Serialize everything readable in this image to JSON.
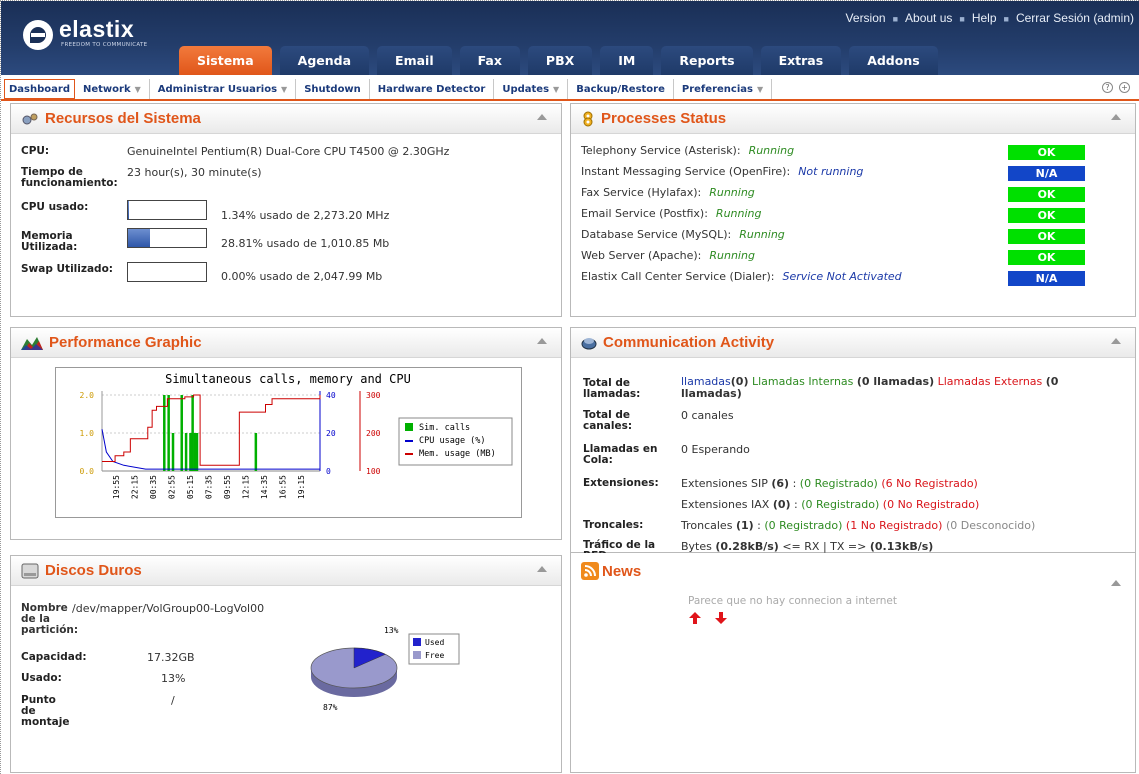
{
  "header": {
    "brand": "elastix",
    "tagline": "FREEDOM TO COMMUNICATE",
    "links": [
      "Version",
      "About us",
      "Help",
      "Cerrar Sesión (admin)"
    ],
    "tabs": [
      "Sistema",
      "Agenda",
      "Email",
      "Fax",
      "PBX",
      "IM",
      "Reports",
      "Extras",
      "Addons"
    ],
    "active_tab": "Sistema"
  },
  "submenu": {
    "items": [
      "Dashboard",
      "Network",
      "Administrar Usuarios",
      "Shutdown",
      "Hardware Detector",
      "Updates",
      "Backup/Restore",
      "Preferencias"
    ],
    "dropdown_marker": "▼",
    "help_icon": "?",
    "add_icon": "+"
  },
  "resources": {
    "title": "Recursos del Sistema",
    "cpu_label": "CPU:",
    "cpu_value": "GenuineIntel Pentium(R) Dual-Core CPU T4500 @ 2.30GHz",
    "uptime_label": "Tiempo de funcionamiento:",
    "uptime_value": "23 hour(s), 30 minute(s)",
    "cpu_used_label": "CPU usado:",
    "cpu_used_text": "1.34% usado de 2,273.20 MHz",
    "cpu_used_pct": 1.34,
    "mem_label": "Memoria Utilizada:",
    "mem_text": "28.81% usado de 1,010.85 Mb",
    "mem_pct": 28.81,
    "swap_label": "Swap Utilizado:",
    "swap_text": "0.00% usado de 2,047.99 Mb",
    "swap_pct": 0.0
  },
  "processes": {
    "title": "Processes Status",
    "items": [
      {
        "name": "Telephony Service (Asterisk):",
        "status": "Running",
        "badge": "OK",
        "state": "ok"
      },
      {
        "name": "Instant Messaging Service (OpenFire):",
        "status": "Not running",
        "badge": "N/A",
        "state": "na"
      },
      {
        "name": "Fax Service (Hylafax):",
        "status": "Running",
        "badge": "OK",
        "state": "ok"
      },
      {
        "name": "Email Service (Postfix):",
        "status": "Running",
        "badge": "OK",
        "state": "ok"
      },
      {
        "name": "Database Service (MySQL):",
        "status": "Running",
        "badge": "OK",
        "state": "ok"
      },
      {
        "name": "Web Server (Apache):",
        "status": "Running",
        "badge": "OK",
        "state": "ok"
      },
      {
        "name": "Elastix Call Center Service (Dialer):",
        "status": "Service Not Activated",
        "badge": "N/A",
        "state": "na"
      }
    ],
    "colors": {
      "ok": "#00e000",
      "na": "#1246c8",
      "running": "#2e8b22",
      "not_running": "#1c3aa8"
    }
  },
  "performance": {
    "title": "Performance Graphic",
    "chart_title": "Simultaneous calls, memory and CPU",
    "left_ticks": [
      "0.0",
      "1.0",
      "2.0"
    ],
    "mid_ticks": [
      "0",
      "20",
      "40"
    ],
    "right_ticks": [
      "100",
      "200",
      "300"
    ],
    "x_ticks": [
      "19:55",
      "22:15",
      "00:35",
      "02:55",
      "05:15",
      "07:35",
      "09:55",
      "12:15",
      "14:35",
      "16:55",
      "19:15"
    ],
    "legend": [
      "Sim. calls",
      "CPU usage (%)",
      "Mem. usage (MB)"
    ],
    "colors": {
      "calls": "#00b000",
      "cpu": "#0000cc",
      "mem": "#cc0000"
    }
  },
  "chart_data": {
    "type": "line",
    "title": "Simultaneous calls, memory and CPU",
    "x_categories": [
      "19:55",
      "22:15",
      "00:35",
      "02:55",
      "05:15",
      "07:35",
      "09:55",
      "12:15",
      "14:35",
      "16:55",
      "19:15"
    ],
    "series": [
      {
        "name": "Sim. calls",
        "axis": "left",
        "ylim": [
          0,
          2
        ],
        "kind": "bar",
        "points": [
          [
            0.28,
            2
          ],
          [
            0.3,
            2
          ],
          [
            0.32,
            1
          ],
          [
            0.36,
            2
          ],
          [
            0.38,
            1
          ],
          [
            0.4,
            1
          ],
          [
            0.41,
            2
          ],
          [
            0.42,
            1
          ],
          [
            0.43,
            1
          ],
          [
            0.7,
            1
          ]
        ]
      },
      {
        "name": "CPU usage (%)",
        "axis": "mid",
        "ylim": [
          0,
          40
        ],
        "points": [
          [
            0.0,
            22
          ],
          [
            0.02,
            10
          ],
          [
            0.05,
            5
          ],
          [
            0.1,
            3
          ],
          [
            0.2,
            1
          ],
          [
            1.0,
            1
          ]
        ]
      },
      {
        "name": "Mem. usage (MB)",
        "axis": "right",
        "ylim": [
          100,
          300
        ],
        "points": [
          [
            0.0,
            125
          ],
          [
            0.05,
            125
          ],
          [
            0.06,
            140
          ],
          [
            0.1,
            150
          ],
          [
            0.13,
            185
          ],
          [
            0.2,
            185
          ],
          [
            0.21,
            215
          ],
          [
            0.23,
            260
          ],
          [
            0.25,
            270
          ],
          [
            0.28,
            270
          ],
          [
            0.3,
            290
          ],
          [
            0.36,
            290
          ],
          [
            0.38,
            295
          ],
          [
            0.42,
            300
          ],
          [
            0.44,
            300
          ],
          [
            0.45,
            115
          ],
          [
            0.62,
            115
          ],
          [
            0.63,
            255
          ],
          [
            0.72,
            255
          ],
          [
            0.75,
            275
          ],
          [
            0.78,
            290
          ],
          [
            1.0,
            300
          ]
        ]
      }
    ]
  },
  "communication": {
    "title": "Communication Activity",
    "total_calls_label": "Total de llamadas:",
    "total_calls_link": "llamadas",
    "total_calls_count": "(0)",
    "internal_label": "Llamadas Internas",
    "internal_count": "(0 llamadas)",
    "external_label": "Llamadas Externas",
    "external_count": "(0 llamadas)",
    "channels_label": "Total de canales:",
    "channels_value": "0 canales",
    "queue_label": "Llamadas en Cola:",
    "queue_value": "0 Esperando",
    "ext_label": "Extensiones:",
    "sip_prefix": "Extensiones SIP",
    "sip_count": "(6)",
    "sip_reg": "(0 Registrado)",
    "sip_noreg": "(6 No Registrado)",
    "iax_prefix": "Extensiones IAX",
    "iax_count": "(0)",
    "iax_reg": "(0 Registrado)",
    "iax_noreg": "(0 No Registrado)",
    "trunk_label": "Troncales:",
    "trunk_prefix": "Troncales",
    "trunk_count": "(1)",
    "trunk_reg": "(0 Registrado)",
    "trunk_noreg": "(1 No Registrado)",
    "trunk_unknown": "(0 Desconocido)",
    "net_label": "Tráfico de la RED:",
    "net_prefix": "Bytes",
    "net_rx": "(0.28kB/s)",
    "net_mid": "<= RX | TX =>",
    "net_tx": "(0.13kB/s)"
  },
  "disks": {
    "title": "Discos Duros",
    "partition_label": "Nombre de la partición:",
    "partition_value": "/dev/mapper/VolGroup00-LogVol00",
    "capacity_label": "Capacidad:",
    "capacity_value": "17.32GB",
    "used_label": "Usado:",
    "used_value": "13%",
    "mount_label": "Punto de montaje",
    "mount_value": "/",
    "pie": {
      "used_pct": 13,
      "free_pct": 87,
      "used_label": "13%",
      "free_label": "87%",
      "legend": [
        "Used",
        "Free"
      ],
      "used_color": "#2222cc",
      "free_color": "#9999cc"
    }
  },
  "news": {
    "title": "News",
    "message": "Parece que no hay connecion a internet"
  }
}
